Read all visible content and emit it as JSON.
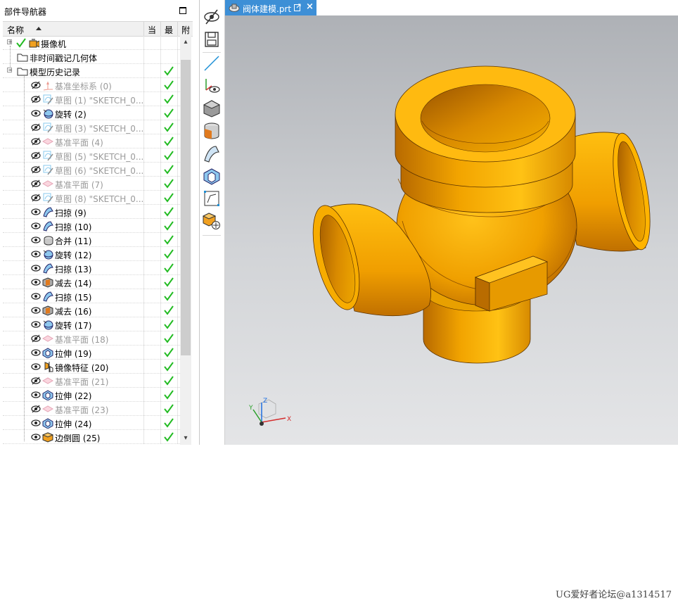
{
  "navigator": {
    "title": "部件导航器",
    "columns": {
      "name": "名称",
      "current": "当",
      "latest": "最",
      "attached": "附"
    },
    "rows": [
      {
        "label": "摄像机",
        "kind": "camera",
        "suppressed": false,
        "latest": false,
        "top_check": true
      },
      {
        "label": "非时间戳记几何体",
        "kind": "folder",
        "suppressed": false,
        "latest": false
      },
      {
        "label": "模型历史记录",
        "kind": "folder",
        "suppressed": false,
        "latest": true
      },
      {
        "label": "基准坐标系 (0)",
        "kind": "csys",
        "suppressed": true,
        "latest": true
      },
      {
        "label": "草图 (1) \"SKETCH_0...",
        "kind": "sketch",
        "suppressed": true,
        "latest": true
      },
      {
        "label": "旋转 (2)",
        "kind": "revolve",
        "suppressed": false,
        "latest": true
      },
      {
        "label": "草图 (3) \"SKETCH_0...",
        "kind": "sketch",
        "suppressed": true,
        "latest": true
      },
      {
        "label": "基准平面 (4)",
        "kind": "plane",
        "suppressed": true,
        "latest": true
      },
      {
        "label": "草图 (5) \"SKETCH_0...",
        "kind": "sketch",
        "suppressed": true,
        "latest": true
      },
      {
        "label": "草图 (6) \"SKETCH_0...",
        "kind": "sketch",
        "suppressed": true,
        "latest": true
      },
      {
        "label": "基准平面 (7)",
        "kind": "plane",
        "suppressed": true,
        "latest": true
      },
      {
        "label": "草图 (8) \"SKETCH_0...",
        "kind": "sketch",
        "suppressed": true,
        "latest": true
      },
      {
        "label": "扫掠 (9)",
        "kind": "sweep",
        "suppressed": false,
        "latest": true
      },
      {
        "label": "扫掠 (10)",
        "kind": "sweep",
        "suppressed": false,
        "latest": true
      },
      {
        "label": "合并 (11)",
        "kind": "unite",
        "suppressed": false,
        "latest": true
      },
      {
        "label": "旋转 (12)",
        "kind": "revolve",
        "suppressed": false,
        "latest": true
      },
      {
        "label": "扫掠 (13)",
        "kind": "sweep",
        "suppressed": false,
        "latest": true
      },
      {
        "label": "减去 (14)",
        "kind": "subtract",
        "suppressed": false,
        "latest": true
      },
      {
        "label": "扫掠 (15)",
        "kind": "sweep",
        "suppressed": false,
        "latest": true
      },
      {
        "label": "减去 (16)",
        "kind": "subtract",
        "suppressed": false,
        "latest": true
      },
      {
        "label": "旋转 (17)",
        "kind": "revolve",
        "suppressed": false,
        "latest": true
      },
      {
        "label": "基准平面 (18)",
        "kind": "plane",
        "suppressed": true,
        "latest": true
      },
      {
        "label": "拉伸 (19)",
        "kind": "extrude",
        "suppressed": false,
        "latest": true
      },
      {
        "label": "镜像特征 (20)",
        "kind": "mirror",
        "suppressed": false,
        "latest": true
      },
      {
        "label": "基准平面 (21)",
        "kind": "plane",
        "suppressed": true,
        "latest": true
      },
      {
        "label": "拉伸 (22)",
        "kind": "extrude",
        "suppressed": false,
        "latest": true
      },
      {
        "label": "基准平面 (23)",
        "kind": "plane",
        "suppressed": true,
        "latest": true
      },
      {
        "label": "拉伸 (24)",
        "kind": "extrude",
        "suppressed": false,
        "latest": true
      },
      {
        "label": "边倒圆 (25)",
        "kind": "blend",
        "suppressed": false,
        "latest": true
      }
    ]
  },
  "toolbar": {
    "buttons": [
      "hide-icon",
      "save-icon",
      "line-icon",
      "show-datum-icon",
      "cube-icon",
      "sectioned-cube-icon",
      "sweep-surface-icon",
      "extrude-icon",
      "fit-icon",
      "add-body-icon"
    ]
  },
  "tab": {
    "label": "阀体建模.prt",
    "close": "×"
  },
  "triad": {
    "x": "X",
    "y": "Y",
    "z": "Z"
  },
  "colors": {
    "accent": "#3d8fd6",
    "check": "#22bb22",
    "model": "#f5a800"
  },
  "watermark": "UG爱好者论坛@a1314517"
}
